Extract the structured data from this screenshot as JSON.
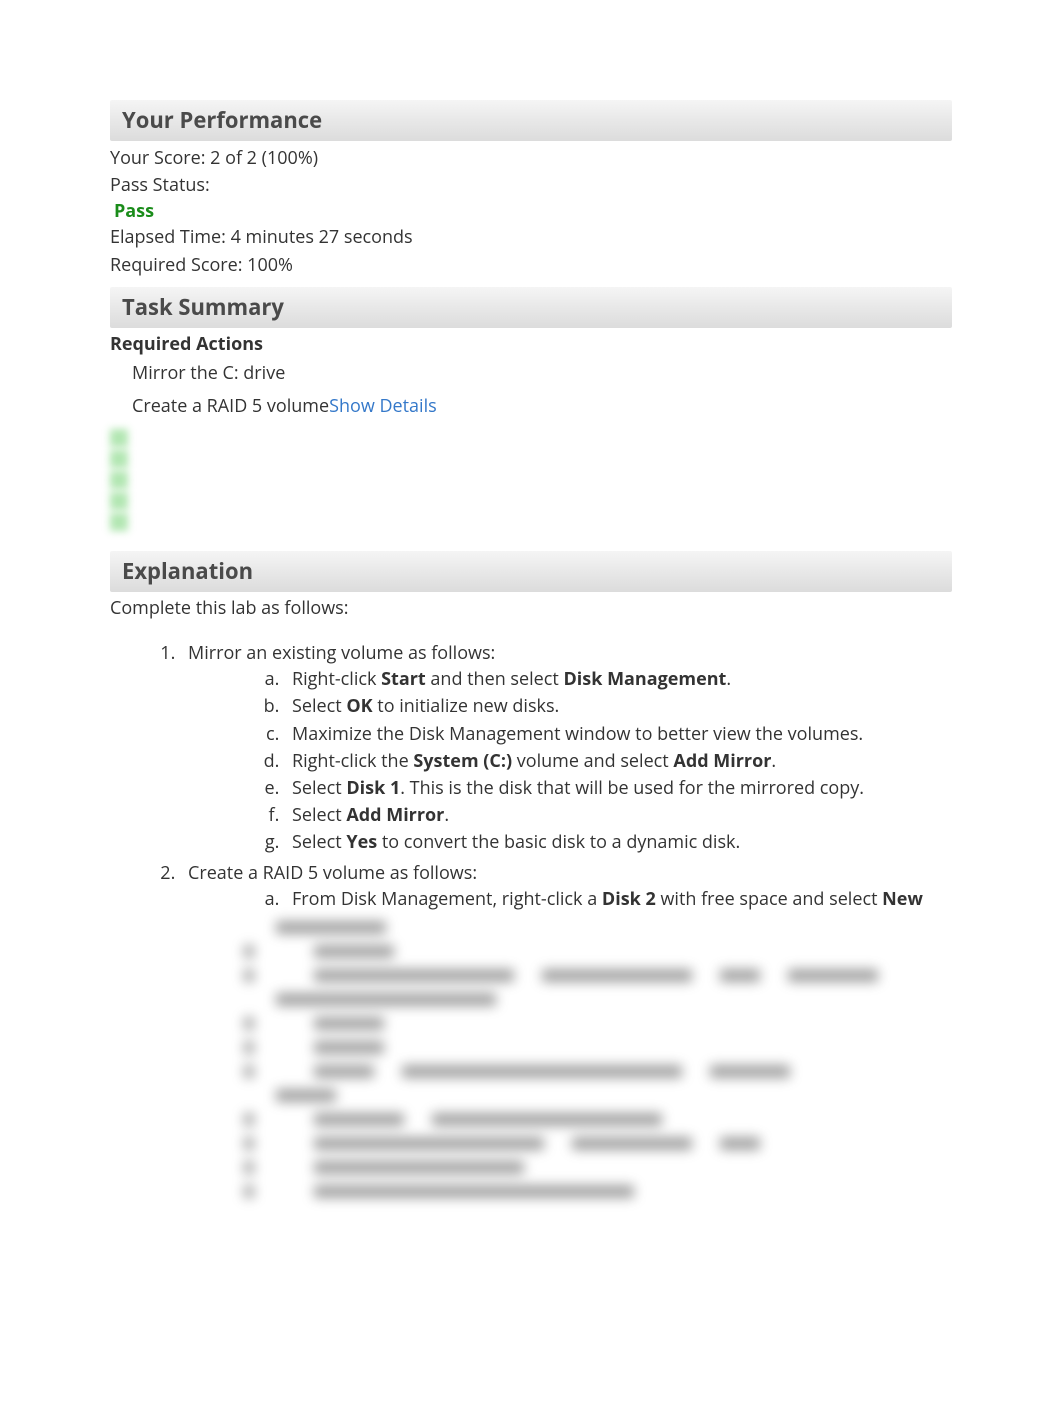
{
  "performance": {
    "heading": "Your Performance",
    "score_line": "Your Score: 2 of 2 (100%)",
    "pass_status_label": "Pass Status:",
    "pass_value": "Pass",
    "elapsed_time": "Elapsed Time: 4 minutes 27 seconds",
    "required_score": "Required Score: 100%"
  },
  "task_summary": {
    "heading": "Task Summary",
    "required_actions_label": "Required Actions",
    "action1": "Mirror the C: drive",
    "action2": "Create a RAID 5 volume",
    "show_details": "Show Details"
  },
  "explanation": {
    "heading": "Explanation",
    "intro": "Complete this lab as follows:",
    "step1_title": "Mirror an existing volume as follows:",
    "step1": {
      "a_pre": "Right-click ",
      "a_b1": "Start",
      "a_mid": " and then select ",
      "a_b2": "Disk Management",
      "a_post": ".",
      "b_pre": "Select ",
      "b_b1": "OK",
      "b_post": " to initialize new disks.",
      "c": "Maximize the Disk Management window to better view the volumes.",
      "d_pre": "Right-click the ",
      "d_b1": "System (C:)",
      "d_mid": " volume and select ",
      "d_b2": "Add Mirror",
      "d_post": ".",
      "e_pre": "Select ",
      "e_b1": "Disk 1",
      "e_post": ". This is the disk that will be used for the mirrored copy.",
      "f_pre": "Select ",
      "f_b1": "Add Mirror",
      "f_post": ".",
      "g_pre": "Select ",
      "g_b1": "Yes",
      "g_post": " to convert the basic disk to a dynamic disk."
    },
    "step2_title": "Create a RAID 5 volume as follows:",
    "step2": {
      "a_pre": "From Disk Management, right-click a ",
      "a_b1": "Disk 2",
      "a_mid": " with free space and select ",
      "a_b2": "New"
    }
  }
}
